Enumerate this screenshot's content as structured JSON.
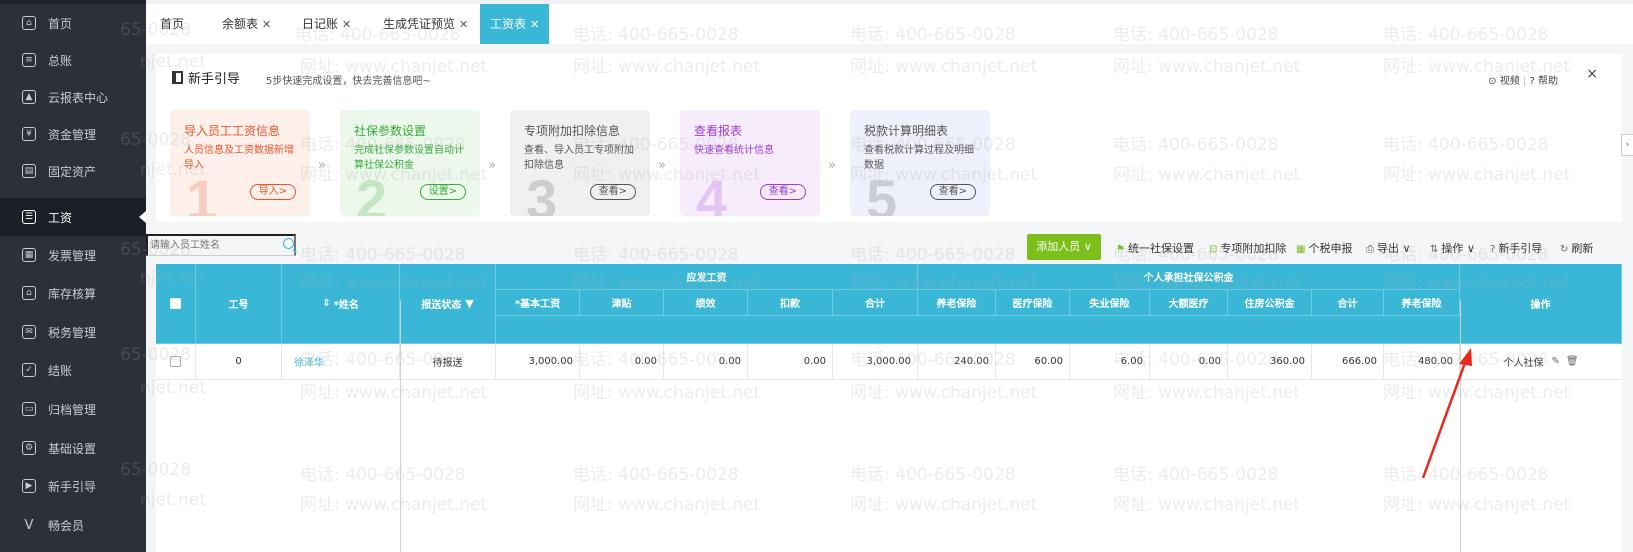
{
  "sidebar": {
    "items": [
      {
        "label": "首页",
        "icon": "home-icon",
        "glyph": "⌂"
      },
      {
        "label": "总账",
        "icon": "ledger-icon",
        "glyph": "≡"
      },
      {
        "label": "云报表中心",
        "icon": "chart-icon",
        "glyph": "▲"
      },
      {
        "label": "资金管理",
        "icon": "money-bag-icon",
        "glyph": "¥"
      },
      {
        "label": "固定资产",
        "icon": "building-icon",
        "glyph": "▤"
      },
      {
        "label": "工资",
        "icon": "payroll-icon",
        "glyph": "☰"
      },
      {
        "label": "发票管理",
        "icon": "invoice-icon",
        "glyph": "▦"
      },
      {
        "label": "库存核算",
        "icon": "warehouse-icon",
        "glyph": "⌂"
      },
      {
        "label": "税务管理",
        "icon": "tax-icon",
        "glyph": "✉"
      },
      {
        "label": "结账",
        "icon": "checkout-icon",
        "glyph": "✓"
      },
      {
        "label": "归档管理",
        "icon": "archive-icon",
        "glyph": "▭"
      },
      {
        "label": "基础设置",
        "icon": "gear-icon",
        "glyph": "⚙"
      },
      {
        "label": "新手引导",
        "icon": "guide-icon",
        "glyph": "▶"
      },
      {
        "label": "畅会员",
        "icon": "vip-icon",
        "glyph": "V"
      }
    ]
  },
  "tabs": [
    {
      "label": "首页",
      "closable": false
    },
    {
      "label": "余额表",
      "closable": true
    },
    {
      "label": "日记账",
      "closable": true
    },
    {
      "label": "生成凭证预览",
      "closable": true
    },
    {
      "label": "工资表",
      "closable": true,
      "active": true
    }
  ],
  "guide": {
    "title": "新手引导",
    "subtitle": "5步快速完成设置，快去完善信息吧~",
    "video": "视频",
    "help": "帮助",
    "close": "×",
    "steps": [
      {
        "title": "导入员工工资信息",
        "desc": "人员信息及工资数据新增导入",
        "button": "导入",
        "num": "1",
        "color": "#e8552b",
        "bg": "#fdf0ea"
      },
      {
        "title": "社保参数设置",
        "desc": "完成社保参数设置自动计算社保公积金",
        "button": "设置",
        "num": "2",
        "color": "#3aa83a",
        "bg": "#ecf8ec"
      },
      {
        "title": "专项附加扣除信息",
        "desc": "查看、导入员工专项附加扣除信息",
        "button": "查看",
        "num": "3",
        "color": "#555555",
        "bg": "#f0f0f2"
      },
      {
        "title": "查看报表",
        "desc": "快速查看统计信息",
        "button": "查看",
        "num": "4",
        "color": "#9b3ccc",
        "bg": "#f6ecfb"
      },
      {
        "title": "税款计算明细表",
        "desc": "查看税款计算过程及明细数据",
        "button": "查看",
        "num": "5",
        "color": "#555555",
        "bg": "#eef0fb"
      }
    ]
  },
  "toolbar": {
    "search_placeholder": "请输入员工姓名",
    "add_button": "添加人员 ∨",
    "tools": [
      {
        "label": "统一社保设置",
        "icon": "social-security-icon"
      },
      {
        "label": "专项附加扣除",
        "icon": "deduction-icon"
      },
      {
        "label": "个税申报",
        "icon": "tax-declare-icon"
      },
      {
        "label": "导出 ∨",
        "icon": "export-icon"
      },
      {
        "label": "操作 ∨",
        "icon": "operation-icon"
      },
      {
        "label": "新手引导",
        "icon": "help-circle-icon"
      },
      {
        "label": "刷新",
        "icon": "refresh-icon"
      }
    ]
  },
  "table": {
    "headers": {
      "id": "工号",
      "name": "*姓名",
      "status": "报送状态",
      "group_pay": "应发工资",
      "base": "*基本工资",
      "allowance": "津贴",
      "performance": "绩效",
      "deduction": "扣款",
      "total": "合计",
      "group_personal": "个人承担社保公积金",
      "pension": "养老保险",
      "medical": "医疗保险",
      "unemployment": "失业保险",
      "serious_illness": "大额医疗",
      "housing": "住房公积金",
      "subtotal": "合计",
      "pension2": "养老保险",
      "ops": "操作"
    },
    "row": {
      "id": "0",
      "name": "徐泽华",
      "status": "待报送",
      "base": "3,000.00",
      "allowance": "0.00",
      "performance": "0.00",
      "deduction": "0.00",
      "total": "3,000.00",
      "pension": "240.00",
      "medical": "60.00",
      "unemployment": "6.00",
      "serious_illness": "0.00",
      "housing": "360.00",
      "subtotal": "666.00",
      "pension2": "480.00",
      "op_label": "个人社保"
    }
  },
  "watermark": {
    "phone": "电话: 400-665-0028",
    "site": "网址: www.chanjet.net",
    "site_short": "njet.net",
    "phone_short": "65-0028"
  },
  "annotation_color": "#e8281d"
}
